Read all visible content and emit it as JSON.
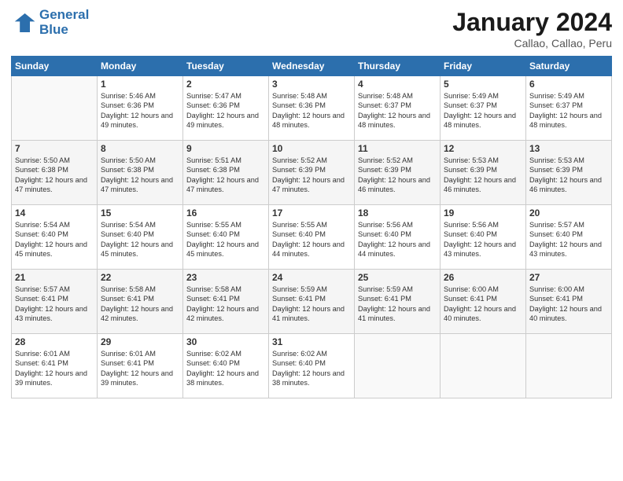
{
  "logo": {
    "line1": "General",
    "line2": "Blue"
  },
  "header": {
    "month": "January 2024",
    "location": "Callao, Callao, Peru"
  },
  "weekdays": [
    "Sunday",
    "Monday",
    "Tuesday",
    "Wednesday",
    "Thursday",
    "Friday",
    "Saturday"
  ],
  "weeks": [
    [
      {
        "day": "",
        "sunrise": "",
        "sunset": "",
        "daylight": ""
      },
      {
        "day": "1",
        "sunrise": "Sunrise: 5:46 AM",
        "sunset": "Sunset: 6:36 PM",
        "daylight": "Daylight: 12 hours and 49 minutes."
      },
      {
        "day": "2",
        "sunrise": "Sunrise: 5:47 AM",
        "sunset": "Sunset: 6:36 PM",
        "daylight": "Daylight: 12 hours and 49 minutes."
      },
      {
        "day": "3",
        "sunrise": "Sunrise: 5:48 AM",
        "sunset": "Sunset: 6:36 PM",
        "daylight": "Daylight: 12 hours and 48 minutes."
      },
      {
        "day": "4",
        "sunrise": "Sunrise: 5:48 AM",
        "sunset": "Sunset: 6:37 PM",
        "daylight": "Daylight: 12 hours and 48 minutes."
      },
      {
        "day": "5",
        "sunrise": "Sunrise: 5:49 AM",
        "sunset": "Sunset: 6:37 PM",
        "daylight": "Daylight: 12 hours and 48 minutes."
      },
      {
        "day": "6",
        "sunrise": "Sunrise: 5:49 AM",
        "sunset": "Sunset: 6:37 PM",
        "daylight": "Daylight: 12 hours and 48 minutes."
      }
    ],
    [
      {
        "day": "7",
        "sunrise": "Sunrise: 5:50 AM",
        "sunset": "Sunset: 6:38 PM",
        "daylight": "Daylight: 12 hours and 47 minutes."
      },
      {
        "day": "8",
        "sunrise": "Sunrise: 5:50 AM",
        "sunset": "Sunset: 6:38 PM",
        "daylight": "Daylight: 12 hours and 47 minutes."
      },
      {
        "day": "9",
        "sunrise": "Sunrise: 5:51 AM",
        "sunset": "Sunset: 6:38 PM",
        "daylight": "Daylight: 12 hours and 47 minutes."
      },
      {
        "day": "10",
        "sunrise": "Sunrise: 5:52 AM",
        "sunset": "Sunset: 6:39 PM",
        "daylight": "Daylight: 12 hours and 47 minutes."
      },
      {
        "day": "11",
        "sunrise": "Sunrise: 5:52 AM",
        "sunset": "Sunset: 6:39 PM",
        "daylight": "Daylight: 12 hours and 46 minutes."
      },
      {
        "day": "12",
        "sunrise": "Sunrise: 5:53 AM",
        "sunset": "Sunset: 6:39 PM",
        "daylight": "Daylight: 12 hours and 46 minutes."
      },
      {
        "day": "13",
        "sunrise": "Sunrise: 5:53 AM",
        "sunset": "Sunset: 6:39 PM",
        "daylight": "Daylight: 12 hours and 46 minutes."
      }
    ],
    [
      {
        "day": "14",
        "sunrise": "Sunrise: 5:54 AM",
        "sunset": "Sunset: 6:40 PM",
        "daylight": "Daylight: 12 hours and 45 minutes."
      },
      {
        "day": "15",
        "sunrise": "Sunrise: 5:54 AM",
        "sunset": "Sunset: 6:40 PM",
        "daylight": "Daylight: 12 hours and 45 minutes."
      },
      {
        "day": "16",
        "sunrise": "Sunrise: 5:55 AM",
        "sunset": "Sunset: 6:40 PM",
        "daylight": "Daylight: 12 hours and 45 minutes."
      },
      {
        "day": "17",
        "sunrise": "Sunrise: 5:55 AM",
        "sunset": "Sunset: 6:40 PM",
        "daylight": "Daylight: 12 hours and 44 minutes."
      },
      {
        "day": "18",
        "sunrise": "Sunrise: 5:56 AM",
        "sunset": "Sunset: 6:40 PM",
        "daylight": "Daylight: 12 hours and 44 minutes."
      },
      {
        "day": "19",
        "sunrise": "Sunrise: 5:56 AM",
        "sunset": "Sunset: 6:40 PM",
        "daylight": "Daylight: 12 hours and 43 minutes."
      },
      {
        "day": "20",
        "sunrise": "Sunrise: 5:57 AM",
        "sunset": "Sunset: 6:40 PM",
        "daylight": "Daylight: 12 hours and 43 minutes."
      }
    ],
    [
      {
        "day": "21",
        "sunrise": "Sunrise: 5:57 AM",
        "sunset": "Sunset: 6:41 PM",
        "daylight": "Daylight: 12 hours and 43 minutes."
      },
      {
        "day": "22",
        "sunrise": "Sunrise: 5:58 AM",
        "sunset": "Sunset: 6:41 PM",
        "daylight": "Daylight: 12 hours and 42 minutes."
      },
      {
        "day": "23",
        "sunrise": "Sunrise: 5:58 AM",
        "sunset": "Sunset: 6:41 PM",
        "daylight": "Daylight: 12 hours and 42 minutes."
      },
      {
        "day": "24",
        "sunrise": "Sunrise: 5:59 AM",
        "sunset": "Sunset: 6:41 PM",
        "daylight": "Daylight: 12 hours and 41 minutes."
      },
      {
        "day": "25",
        "sunrise": "Sunrise: 5:59 AM",
        "sunset": "Sunset: 6:41 PM",
        "daylight": "Daylight: 12 hours and 41 minutes."
      },
      {
        "day": "26",
        "sunrise": "Sunrise: 6:00 AM",
        "sunset": "Sunset: 6:41 PM",
        "daylight": "Daylight: 12 hours and 40 minutes."
      },
      {
        "day": "27",
        "sunrise": "Sunrise: 6:00 AM",
        "sunset": "Sunset: 6:41 PM",
        "daylight": "Daylight: 12 hours and 40 minutes."
      }
    ],
    [
      {
        "day": "28",
        "sunrise": "Sunrise: 6:01 AM",
        "sunset": "Sunset: 6:41 PM",
        "daylight": "Daylight: 12 hours and 39 minutes."
      },
      {
        "day": "29",
        "sunrise": "Sunrise: 6:01 AM",
        "sunset": "Sunset: 6:41 PM",
        "daylight": "Daylight: 12 hours and 39 minutes."
      },
      {
        "day": "30",
        "sunrise": "Sunrise: 6:02 AM",
        "sunset": "Sunset: 6:40 PM",
        "daylight": "Daylight: 12 hours and 38 minutes."
      },
      {
        "day": "31",
        "sunrise": "Sunrise: 6:02 AM",
        "sunset": "Sunset: 6:40 PM",
        "daylight": "Daylight: 12 hours and 38 minutes."
      },
      {
        "day": "",
        "sunrise": "",
        "sunset": "",
        "daylight": ""
      },
      {
        "day": "",
        "sunrise": "",
        "sunset": "",
        "daylight": ""
      },
      {
        "day": "",
        "sunrise": "",
        "sunset": "",
        "daylight": ""
      }
    ]
  ]
}
